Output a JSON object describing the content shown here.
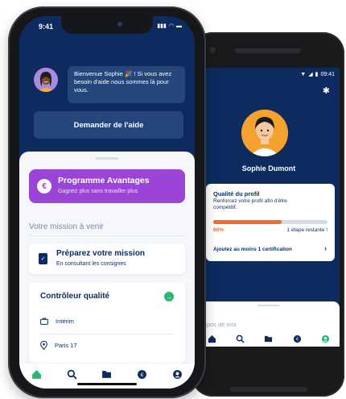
{
  "android": {
    "status_time": "09:41",
    "profile_name": "Sophie Dumont",
    "quality_card": {
      "title": "Qualité du profil",
      "subtitle": "Renforcez votre profil afin d'être compétitif.",
      "progress_percent": 60,
      "progress_label": "60%",
      "remaining": "1 étape restante !",
      "action": "Ajoutez au moins 1 certification"
    },
    "section_about": "propos de moi",
    "nav": [
      "home-icon",
      "search-icon",
      "folder-icon",
      "coin-icon",
      "profile-icon"
    ]
  },
  "iphone": {
    "status_time": "9:41",
    "welcome": "Bienvenue Sophie 🎉 ! Si vous avez besoin d'aide nous sommes là pour vous.",
    "help_button": "Demander de l'aide",
    "promo": {
      "title": "Programme Avantages",
      "subtitle": "Gagnez plus sans travailler plus"
    },
    "mission_heading": "Votre mission à venir",
    "prepare": {
      "title": "Préparez votre mission",
      "subtitle": "En consultant les consignes"
    },
    "job": {
      "title": "Contrôleur qualité",
      "contract": "Intérim",
      "location": "Paris 17"
    },
    "nav": [
      "home-icon",
      "search-icon",
      "folder-icon",
      "coin-icon",
      "profile-icon"
    ]
  },
  "colors": {
    "navy": "#0d2b5e",
    "promo_purple": "#9b44d8",
    "orange": "#f26a2e",
    "green": "#2bb673",
    "avatar_yellow": "#f4a22d"
  }
}
